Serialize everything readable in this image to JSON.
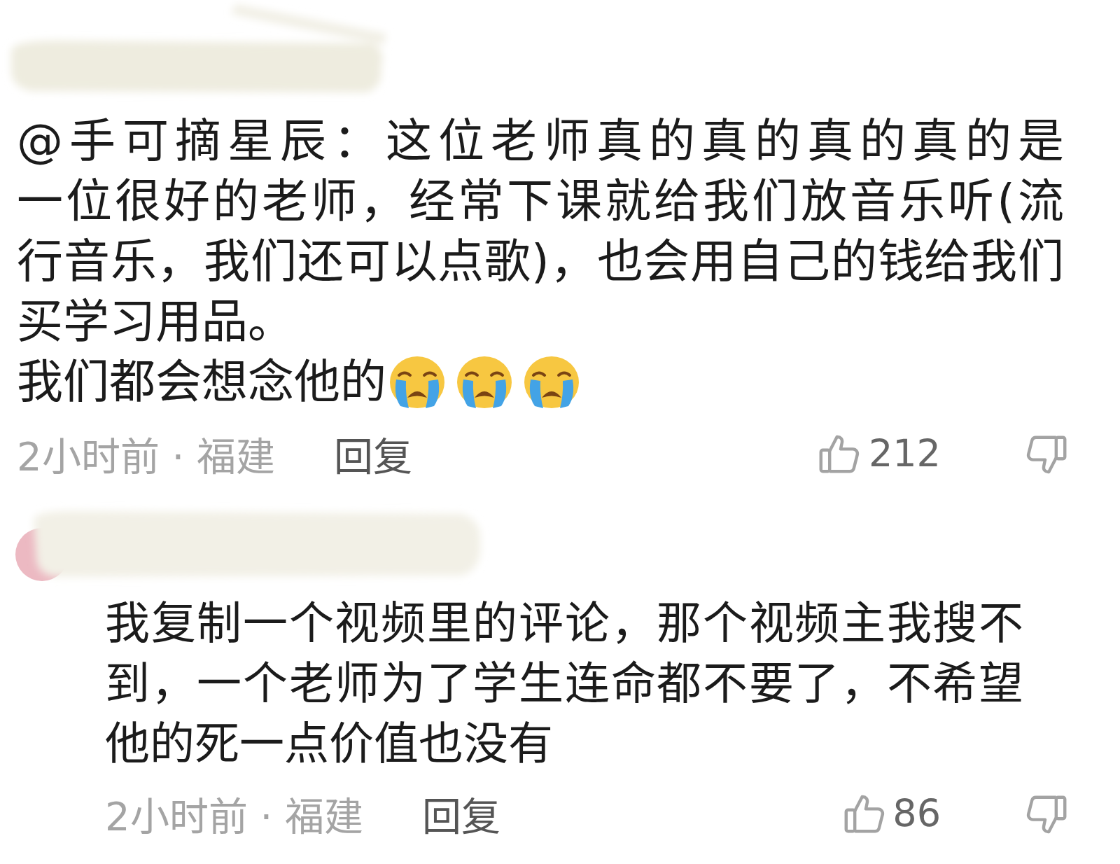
{
  "comments": [
    {
      "kind": "flush",
      "paragraphs": [
        {
          "lines": [
            "@手可摘星辰：这位老师真的真的真的真的是",
            "一位很好的老师，经常下课就给我们放音乐听(流",
            "行音乐，我们还可以点歌)，也会用自己的钱给我们",
            "买学习用品。"
          ]
        },
        {
          "lines": [
            "我们都会想念他的"
          ]
        }
      ],
      "emojis": [
        {
          "kind": "crying"
        },
        {
          "kind": "crying"
        },
        {
          "kind": "crying"
        }
      ],
      "meta": "2小时前 · 福建",
      "reply_label": "回复",
      "likes": "212"
    },
    {
      "kind": "with-avatar",
      "paragraphs": [
        {
          "lines": [
            "我复制一个视频里的评论，那个视频主我搜不",
            "到，一个老师为了学生连命都不要了，不希望",
            "他的死一点价值也没有"
          ]
        }
      ],
      "meta": "2小时前 · 福建",
      "reply_label": "回复",
      "likes": "86"
    }
  ]
}
